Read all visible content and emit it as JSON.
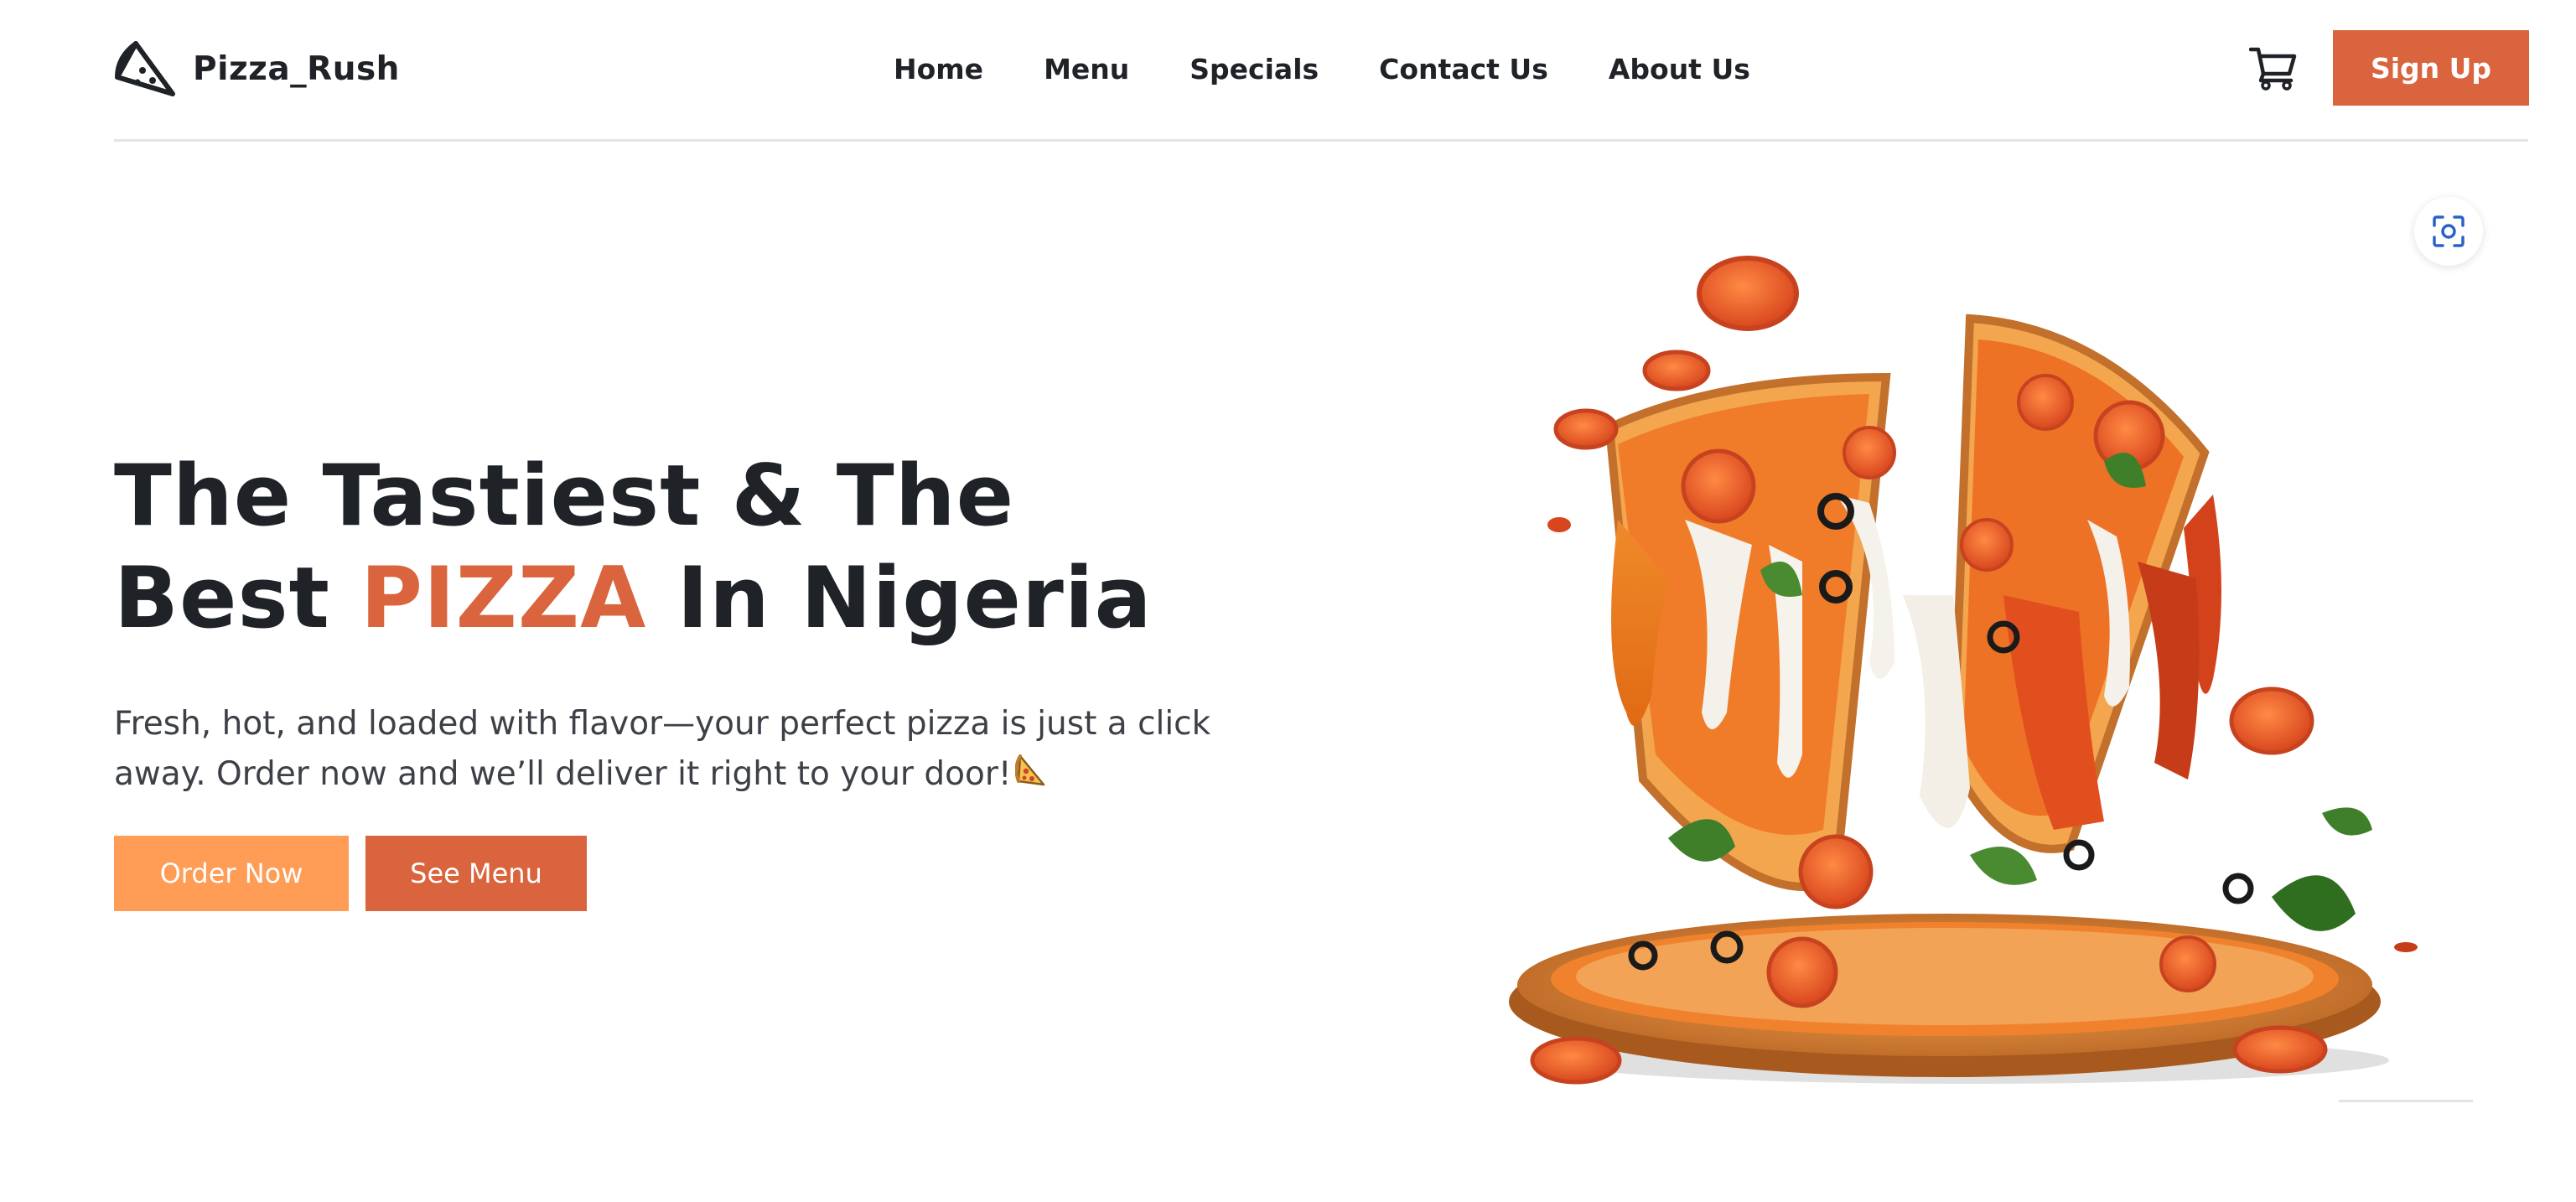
{
  "header": {
    "brand_name": "Pizza_Rush",
    "brand_icon": "pizza-slice-icon",
    "nav": [
      {
        "label": "Home"
      },
      {
        "label": "Menu"
      },
      {
        "label": "Specials"
      },
      {
        "label": "Contact Us"
      },
      {
        "label": "About Us"
      }
    ],
    "cart_icon": "shopping-cart-icon",
    "signup_label": "Sign Up"
  },
  "hero": {
    "title_line1": "The Tastiest & The",
    "title_line2_start": "Best ",
    "title_highlight": "PIZZA",
    "title_line2_end": " In Nigeria",
    "description": "Fresh, hot, and loaded with flavor—your perfect pizza is just a click away. Order now and we’ll deliver it right to your door!",
    "description_emoji": "pizza-emoji",
    "order_button": "Order Now",
    "menu_button": "See Menu",
    "image_subject": "pizza-slices-with-melting-cheese",
    "lens_icon": "visual-search-icon"
  },
  "colors": {
    "accent": "#d9643d",
    "order_button": "#ff9c55",
    "text_dark": "#1f2227",
    "text_body": "#3d4047",
    "divider": "#e3e4e6"
  }
}
